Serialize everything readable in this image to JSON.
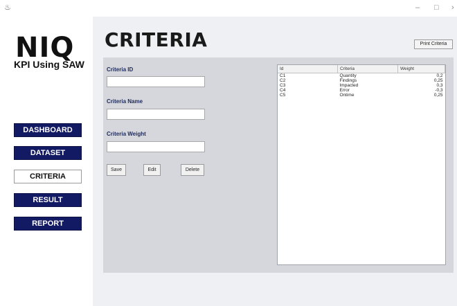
{
  "window": {
    "minimize": "–",
    "maximize": "□",
    "close": "›"
  },
  "sidebar": {
    "logo": "NIQ",
    "subtitle": "KPI Using SAW",
    "nav": [
      {
        "label": "DASHBOARD",
        "active": false
      },
      {
        "label": "DATASET",
        "active": false
      },
      {
        "label": "CRITERIA",
        "active": true
      },
      {
        "label": "RESULT",
        "active": false
      },
      {
        "label": "REPORT",
        "active": false
      }
    ]
  },
  "main": {
    "title": "CRITERIA",
    "print_button": "Print Criteria"
  },
  "form": {
    "criteria_id_label": "Criteria ID",
    "criteria_id_value": "",
    "criteria_name_label": "Criteria Name",
    "criteria_name_value": "",
    "criteria_weight_label": "Criteria Weight",
    "criteria_weight_value": "",
    "save_label": "Save",
    "edit_label": "Edit",
    "delete_label": "Delete"
  },
  "table": {
    "headers": [
      "Id",
      "Criteria",
      "Weight"
    ],
    "rows": [
      [
        "C1",
        "Quantity",
        "0,2"
      ],
      [
        "C2",
        "Findings",
        "0,25"
      ],
      [
        "C3",
        "Impacted",
        "0,3"
      ],
      [
        "C4",
        "Error",
        "-0,3"
      ],
      [
        "C5",
        "Ontime",
        "0,25"
      ]
    ]
  }
}
